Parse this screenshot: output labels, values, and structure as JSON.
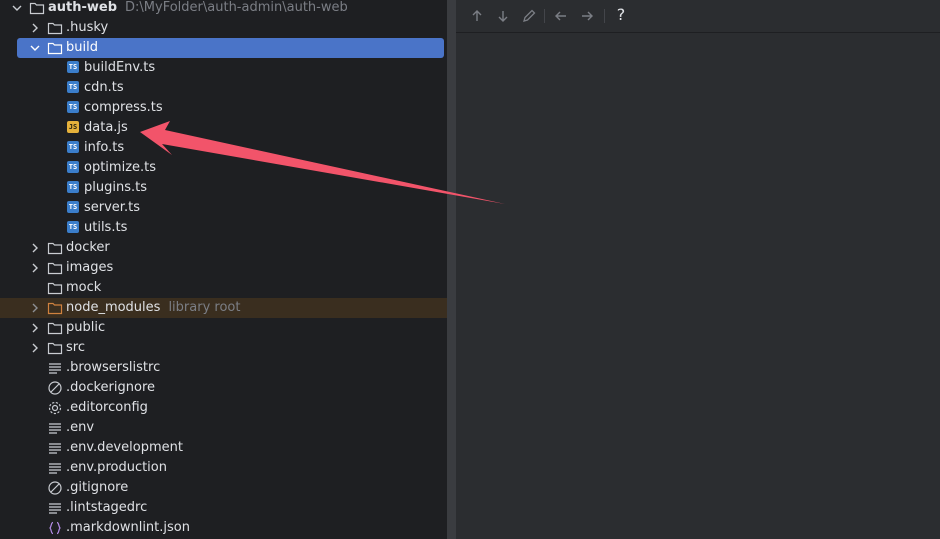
{
  "tree": {
    "root": {
      "label": "auth-web",
      "path": "D:\\MyFolder\\auth-admin\\auth-web"
    },
    "husky": {
      "label": ".husky"
    },
    "build": {
      "label": "build",
      "files": [
        {
          "label": "buildEnv.ts",
          "type": "TS"
        },
        {
          "label": "cdn.ts",
          "type": "TS"
        },
        {
          "label": "compress.ts",
          "type": "TS"
        },
        {
          "label": "data.js",
          "type": "JS"
        },
        {
          "label": "info.ts",
          "type": "TS"
        },
        {
          "label": "optimize.ts",
          "type": "TS"
        },
        {
          "label": "plugins.ts",
          "type": "TS"
        },
        {
          "label": "server.ts",
          "type": "TS"
        },
        {
          "label": "utils.ts",
          "type": "TS"
        }
      ]
    },
    "folders": [
      {
        "label": "docker"
      },
      {
        "label": "images"
      },
      {
        "label": "mock"
      }
    ],
    "node_modules": {
      "label": "node_modules",
      "suffix": "library root"
    },
    "folders2": [
      {
        "label": "public"
      },
      {
        "label": "src"
      }
    ],
    "dotfiles": [
      {
        "label": ".browserslistrc",
        "icon": "lines-icon"
      },
      {
        "label": ".dockerignore",
        "icon": "ignore-icon"
      },
      {
        "label": ".editorconfig",
        "icon": "gear-icon"
      },
      {
        "label": ".env",
        "icon": "lines-icon"
      },
      {
        "label": ".env.development",
        "icon": "lines-icon"
      },
      {
        "label": ".env.production",
        "icon": "lines-icon"
      },
      {
        "label": ".gitignore",
        "icon": "ignore-icon"
      },
      {
        "label": ".lintstagedrc",
        "icon": "lines-icon"
      },
      {
        "label": ".markdownlint.json",
        "icon": "json-icon"
      }
    ]
  },
  "toolbar": {
    "icons": [
      "arrow-up-icon",
      "arrow-down-icon",
      "pencil-icon",
      "arrow-left-icon",
      "arrow-right-icon"
    ],
    "help_label": "?"
  },
  "colors": {
    "selection": "#4a74c8",
    "annotation_arrow": "#f2546a",
    "ts_badge": "#3b7ecb",
    "js_badge": "#e5b13b"
  }
}
